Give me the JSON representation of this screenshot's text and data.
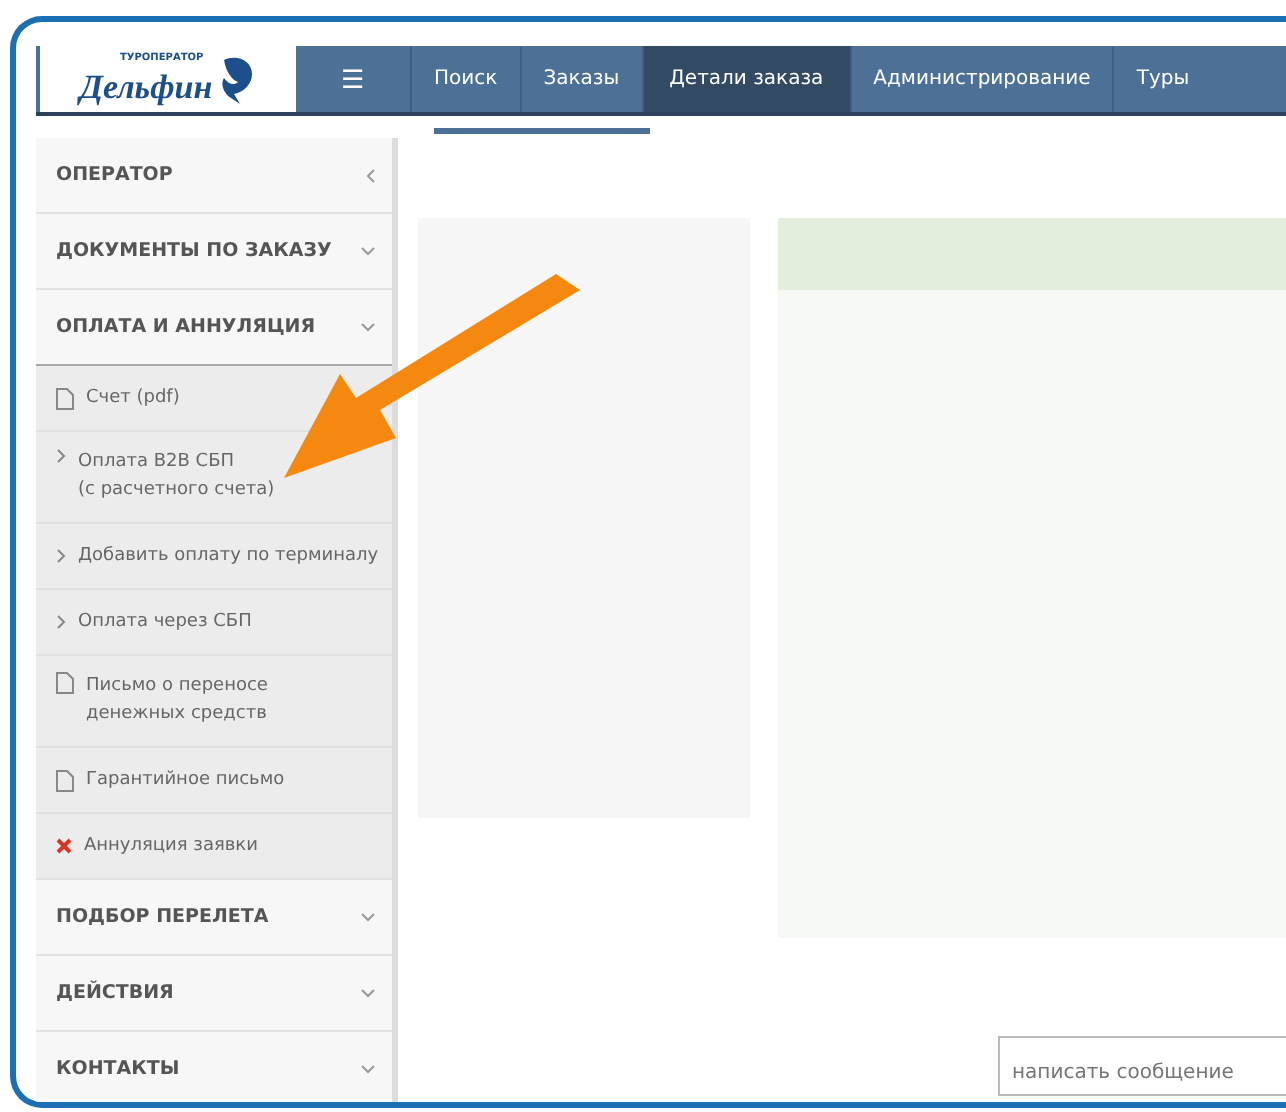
{
  "logo": {
    "small": "ТУРОПЕРАТОР",
    "name": "Дельфин"
  },
  "menu_icon": "☰",
  "tabs": [
    {
      "label": "Поиск",
      "selected": false
    },
    {
      "label": "Заказы",
      "selected": false
    },
    {
      "label": "Детали заказа",
      "selected": true
    },
    {
      "label": "Администрирование",
      "selected": false
    },
    {
      "label": "Туры",
      "selected": false
    }
  ],
  "sidebar": [
    {
      "kind": "panel",
      "label": "ОПЕРАТОР",
      "expanded": false
    },
    {
      "kind": "section",
      "label": "ДОКУМЕНТЫ ПО ЗАКАЗУ",
      "expanded": false
    },
    {
      "kind": "section",
      "label": "ОПЛАТА И АННУЛЯЦИЯ",
      "expanded": true,
      "children": [
        {
          "kind": "doc",
          "label": "Счет (pdf)"
        },
        {
          "kind": "arrow",
          "label": "Оплата B2B СБП\n(с расчетного счета)"
        },
        {
          "kind": "arrow",
          "label": "Добавить оплату по терминалу"
        },
        {
          "kind": "arrow",
          "label": "Оплата через СБП"
        },
        {
          "kind": "doc",
          "label": "Письмо о переносе\nденежных средств"
        },
        {
          "kind": "doc",
          "label": "Гарантийное письмо"
        },
        {
          "kind": "cross",
          "label": "Аннуляция заявки"
        }
      ]
    },
    {
      "kind": "section",
      "label": "ПОДБОР ПЕРЕЛЕТА",
      "expanded": false
    },
    {
      "kind": "section",
      "label": "ДЕЙСТВИЯ",
      "expanded": false
    },
    {
      "kind": "section",
      "label": "КОНТАКТЫ",
      "expanded": false
    }
  ],
  "message": {
    "placeholder": "написать сообщение"
  }
}
